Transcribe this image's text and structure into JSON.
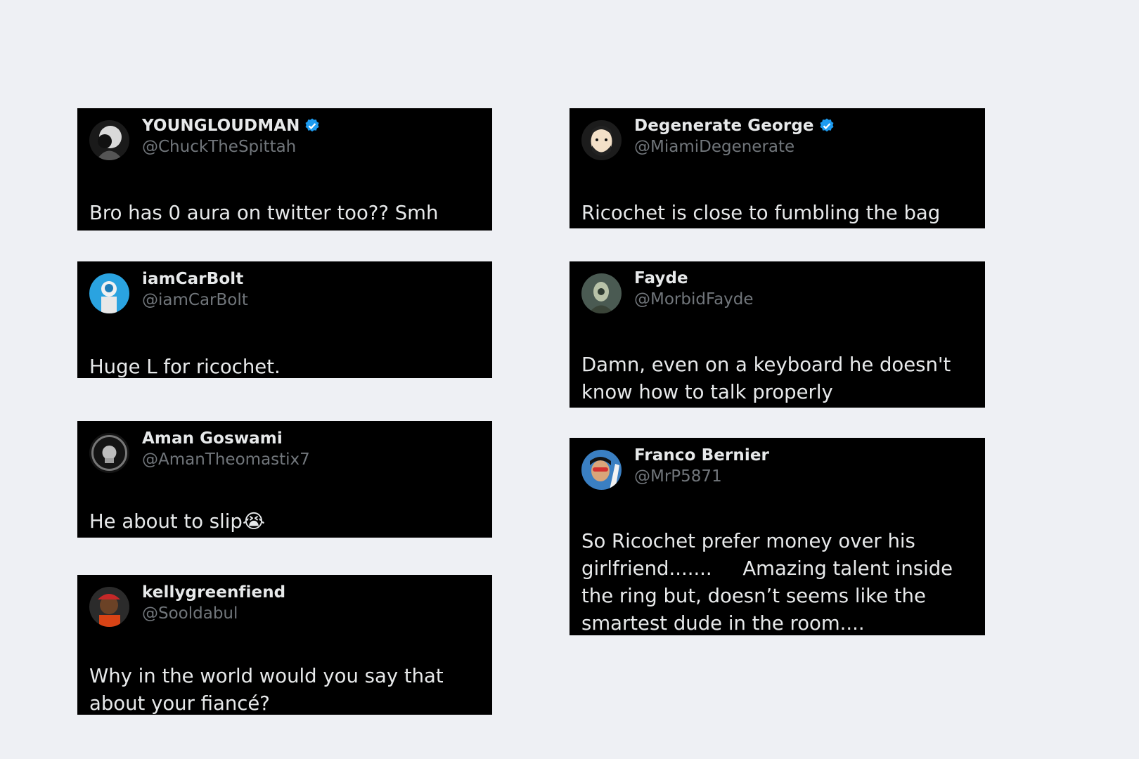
{
  "tweets": [
    {
      "name": "YOUNGLOUDMAN",
      "handle": "@ChuckTheSpittah",
      "verified": true,
      "text": "Bro has 0 aura on twitter too?? Smh"
    },
    {
      "name": "iamCarBolt",
      "handle": "@iamCarBolt",
      "verified": false,
      "text": "Huge L for ricochet."
    },
    {
      "name": "Aman Goswami",
      "handle": "@AmanTheomastix7",
      "verified": false,
      "text": "He about to slip😭"
    },
    {
      "name": "kellygreenfiend",
      "handle": "@Sooldabul",
      "verified": false,
      "text": "Why in the world would you say that about your fiancé?"
    },
    {
      "name": "Degenerate George",
      "handle": "@MiamiDegenerate",
      "verified": true,
      "text": "Ricochet is close to fumbling the bag"
    },
    {
      "name": "Fayde",
      "handle": "@MorbidFayde",
      "verified": false,
      "text": "Damn, even on a keyboard he doesn't know how to talk properly"
    },
    {
      "name": "Franco Bernier",
      "handle": "@MrP5871",
      "verified": false,
      "text": "So Ricochet prefer money over his girlfriend.......     Amazing talent inside the ring but, doesn’t seems like the smartest dude in the room...."
    }
  ],
  "colors": {
    "card": "#000000",
    "name": "#e7e9ea",
    "handle": "#71767b",
    "verified": "#1d9bf0",
    "background": "#eef0f4"
  }
}
